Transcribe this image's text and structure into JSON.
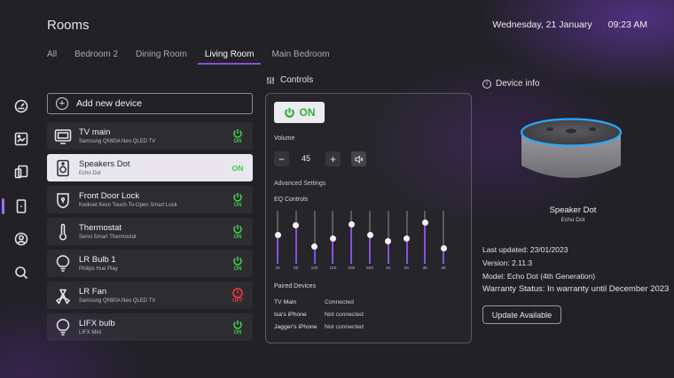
{
  "header": {
    "title": "Rooms",
    "date": "Wednesday, 21 January",
    "time": "09:23 AM"
  },
  "tabs": [
    {
      "label": "All",
      "active": false
    },
    {
      "label": "Bedroom 2",
      "active": false
    },
    {
      "label": "Dining Room",
      "active": false
    },
    {
      "label": "Living Room",
      "active": true
    },
    {
      "label": "Main Bedroom",
      "active": false
    }
  ],
  "sidebar": {
    "icons": [
      "dashboard-icon",
      "gallery-icon",
      "devices-icon",
      "device-selected-icon",
      "user-icon",
      "search-icon"
    ]
  },
  "devices": {
    "add_label": "Add new device",
    "list": [
      {
        "name": "TV main",
        "sub": "Samsung QN90A Neo QLED TV",
        "status": "ON",
        "icon": "tv-icon"
      },
      {
        "name": "Speakers Dot",
        "sub": "Echo Dot",
        "status": "ON",
        "icon": "speaker-icon"
      },
      {
        "name": "Front Door Lock",
        "sub": "Kwikset Kevo Touch-To-Open Smart Lock",
        "status": "ON",
        "icon": "lock-icon"
      },
      {
        "name": "Thermostat",
        "sub": "Sensi Smart Thermostat",
        "status": "ON",
        "icon": "thermometer-icon"
      },
      {
        "name": "LR Bulb 1",
        "sub": "Philips Hue Play",
        "status": "ON",
        "icon": "bulb-icon"
      },
      {
        "name": "LR Fan",
        "sub": "Samsung QN90A Neo QLED TV",
        "status": "OFF",
        "icon": "fan-icon"
      },
      {
        "name": "LIFX bulb",
        "sub": "LIFX Mini",
        "status": "ON",
        "icon": "bulb-icon"
      }
    ]
  },
  "controls": {
    "title": "Controls",
    "power_label": "ON",
    "volume_label": "Volume",
    "volume_value": "45",
    "advanced_label": "Advanced Settings",
    "eq_label": "EQ Controls",
    "eq_bands": [
      {
        "label": "25",
        "level": 0.55
      },
      {
        "label": "50",
        "level": 0.72
      },
      {
        "label": "100",
        "level": 0.32
      },
      {
        "label": "150",
        "level": 0.48
      },
      {
        "label": "300",
        "level": 0.75
      },
      {
        "label": "500",
        "level": 0.55
      },
      {
        "label": "1K",
        "level": 0.42
      },
      {
        "label": "2K",
        "level": 0.47
      },
      {
        "label": "3K",
        "level": 0.78
      },
      {
        "label": "4K",
        "level": 0.3
      }
    ],
    "paired_label": "Paired Devices",
    "paired": [
      {
        "name": "TV Main",
        "status": "Connected"
      },
      {
        "name": "Isa's iPhone",
        "status": "Not connected"
      },
      {
        "name": "Jagger's iPhone",
        "status": "Not connected"
      }
    ]
  },
  "device_info": {
    "title": "Device info",
    "name": "Speaker Dot",
    "sub": "Echo Dot",
    "last_updated": "Last updated: 23/01/2023",
    "version": "Version:  2.11.3",
    "model": "Model: Echo Dot (4th Generation)",
    "warranty": "Warranty Status: In warranty until December 2023",
    "update_label": "Update Available"
  },
  "colors": {
    "accent": "#8a4fe0",
    "on_green": "#3ec84a",
    "off_red": "#e23b3b",
    "background": "#212126"
  }
}
